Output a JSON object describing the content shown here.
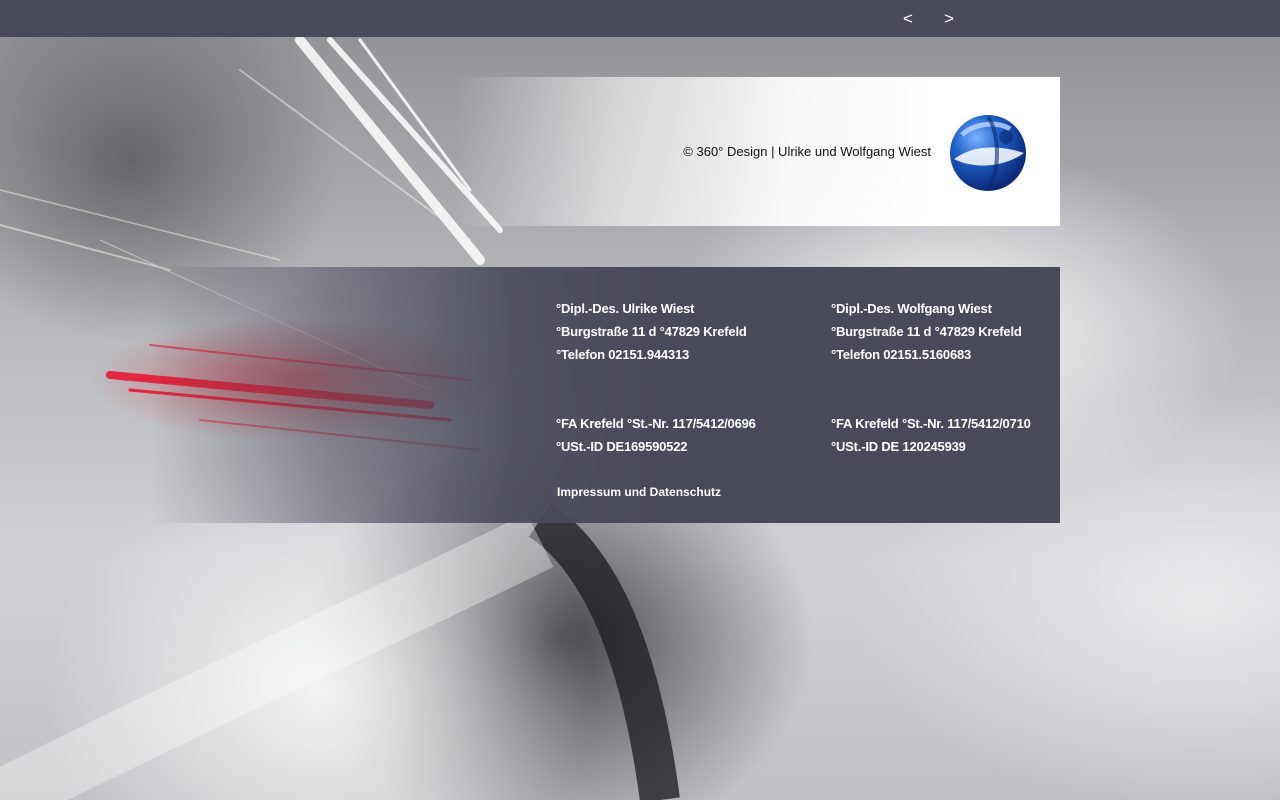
{
  "nav": {
    "prev_label": "<",
    "next_label": ">"
  },
  "header": {
    "copyright": "© 360° Design | Ulrike und Wolfgang Wiest",
    "logo_icon": "globe-logo-icon"
  },
  "contacts": [
    {
      "name": "°Dipl.-Des. Ulrike Wiest",
      "address": "°Burgstraße 11 d °47829 Krefeld",
      "phone": "°Telefon 02151.944313",
      "tax": "°FA Krefeld °St.-Nr. 117/5412/0696",
      "vat": "°USt.-ID DE169590522"
    },
    {
      "name": "°Dipl.-Des. Wolfgang Wiest",
      "address": "°Burgstraße 11 d °47829 Krefeld",
      "phone": "°Telefon 02151.5160683",
      "tax": "°FA Krefeld °St.-Nr. 117/5412/0710",
      "vat": "°USt.-ID DE 120245939"
    }
  ],
  "footer": {
    "impressum_link": "Impressum und Datenschutz"
  },
  "colors": {
    "bar": "#494a59",
    "panel": "#494a59",
    "text_light": "#ffffff",
    "logo_blue": "#1e5fc8"
  }
}
